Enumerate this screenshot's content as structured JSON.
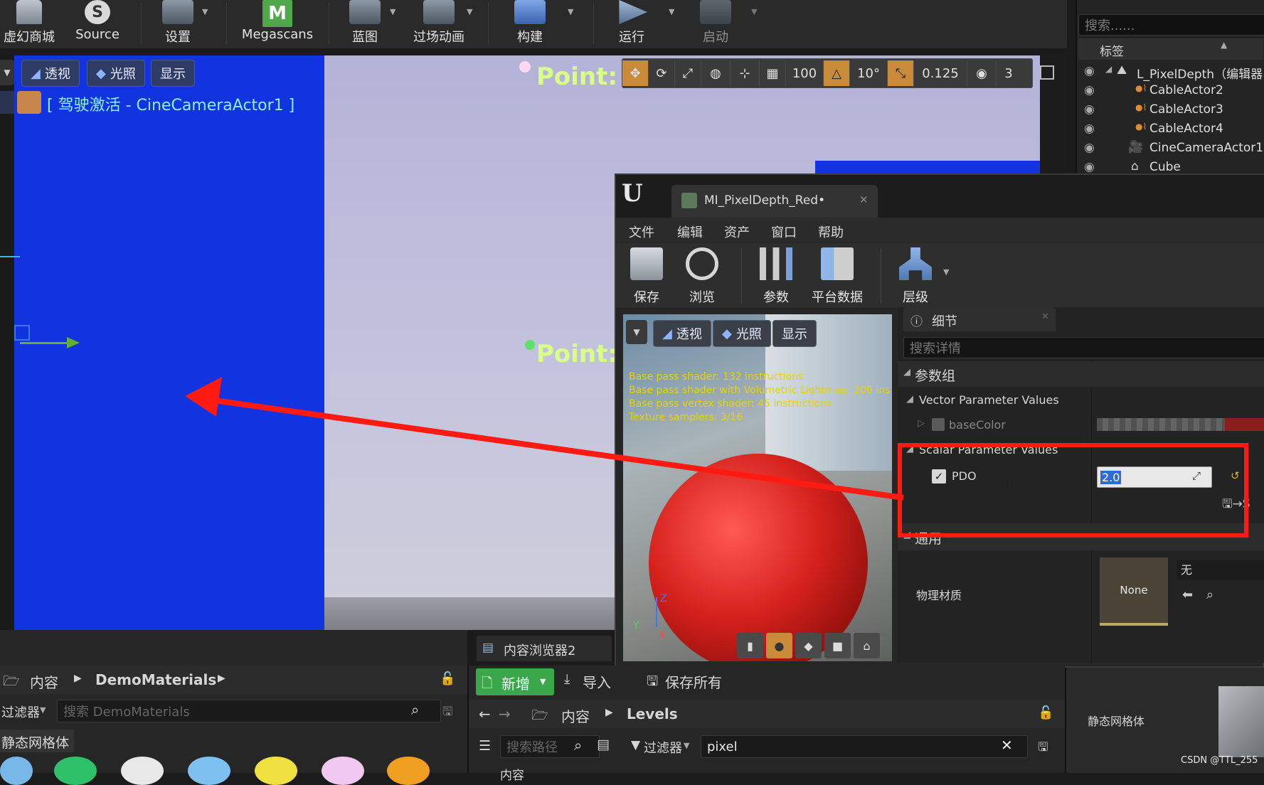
{
  "main_toolbar": {
    "items": [
      {
        "label": "虚幻商城"
      },
      {
        "label": "Source"
      },
      {
        "label": "设置"
      },
      {
        "label": "Megascans"
      },
      {
        "label": "蓝图"
      },
      {
        "label": "过场动画"
      },
      {
        "label": "构建"
      },
      {
        "label": "运行"
      },
      {
        "label": "启动"
      }
    ]
  },
  "viewport": {
    "view_mode": "透视",
    "lighting": "光照",
    "show": "显示",
    "pilot_label": "[ 驾驶激活 - CineCameraActor1 ]",
    "point_label_1": "Point: I",
    "point_label_2": "Point:",
    "grid_snap": "100",
    "rotation_snap": "10°",
    "scale_snap": "0.125",
    "camera_speed": "3"
  },
  "outliner": {
    "search_placeholder": "搜索......",
    "column_label": "标签",
    "items": [
      {
        "label": "L_PixelDepth（编辑器"
      },
      {
        "label": "CableActor2"
      },
      {
        "label": "CableActor3"
      },
      {
        "label": "CableActor4"
      },
      {
        "label": "CineCameraActor1"
      },
      {
        "label": "Cube"
      }
    ]
  },
  "material_editor": {
    "tab_title": "MI_PixelDepth_Red•",
    "menu": [
      "文件",
      "编辑",
      "资产",
      "窗口",
      "帮助"
    ],
    "toolbar": [
      {
        "label": "保存"
      },
      {
        "label": "浏览"
      },
      {
        "label": "参数"
      },
      {
        "label": "平台数据"
      },
      {
        "label": "层级"
      }
    ],
    "preview": {
      "view_mode": "透视",
      "lighting": "光照",
      "show": "显示",
      "stats": [
        "Base pass shader: 132 instructions",
        "Base pass shader with Volumetric Lightmap: 206 ins",
        "Base pass vertex shader: 45 instructions",
        "Texture samplers: 3/16"
      ],
      "axis_z": "Z",
      "axis_y": "Y",
      "axis_x": "X"
    },
    "details": {
      "tab_label": "细节",
      "search_placeholder": "搜索详情",
      "group_params": "参数组",
      "vector_section": "Vector Parameter Values",
      "vector_param": "baseColor",
      "scalar_section": "Scalar Parameter Values",
      "scalar_param": "PDO",
      "scalar_value": "2.0",
      "general_section": "通用",
      "phys_material_label": "物理材质",
      "phys_material_thumb": "None",
      "phys_material_value": "无"
    }
  },
  "content_browser_left": {
    "path_root": "内容",
    "path_folder": "DemoMaterials",
    "filter_label": "过滤器",
    "search_placeholder": "搜索 DemoMaterials",
    "category": "静态网格体"
  },
  "content_browser_mid": {
    "tab_label": "内容浏览器2",
    "new_button": "新增",
    "import_button": "导入",
    "save_all_button": "保存所有",
    "path_root": "内容",
    "path_folder": "Levels",
    "path_search_placeholder": "搜索路径",
    "filter_label": "过滤器",
    "search_value": "pixel",
    "row_root": "内容"
  },
  "right_panel": {
    "category": "静态网格体"
  },
  "watermark": "CSDN @TTL_255",
  "colors": {
    "annotation_red": "#ff1a12",
    "pip_blue": "#1233e0",
    "accent_green": "#3aa84a"
  }
}
